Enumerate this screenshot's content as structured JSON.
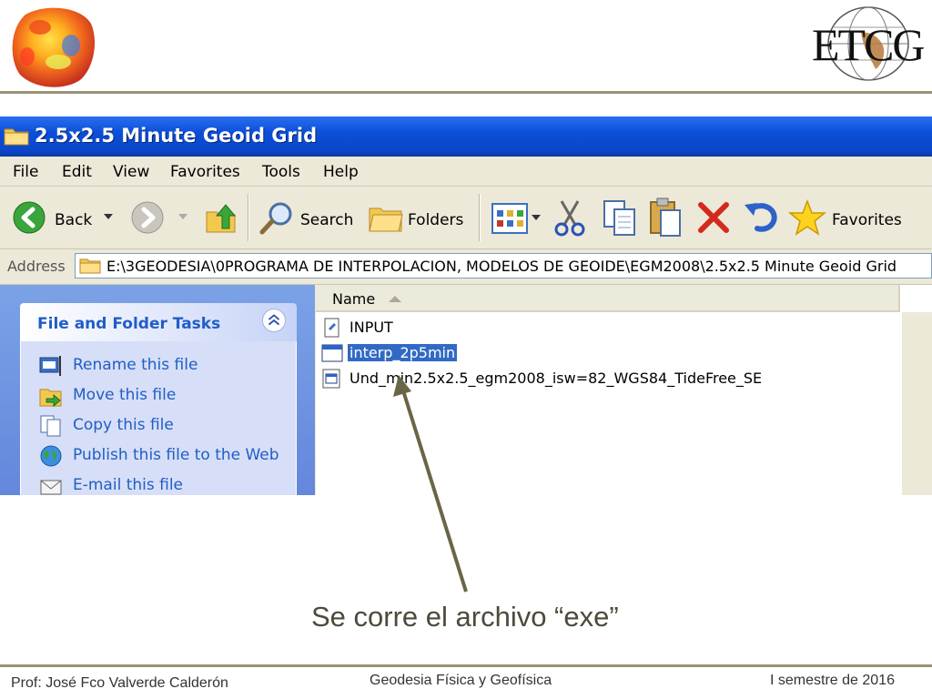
{
  "slide": {
    "logo_text": "ETCG",
    "caption": "Se corre el archivo “exe”",
    "footer": {
      "left": "Prof: José Fco Valverde Calderón",
      "center": "Geodesia Física y Geofísica",
      "right": "I semestre de 2016"
    },
    "colors": {
      "rule": "#9a9374",
      "caption": "#4d4a3a",
      "arrow": "#6b6547"
    }
  },
  "window": {
    "title": "2.5x2.5 Minute Geoid Grid",
    "menu": [
      "File",
      "Edit",
      "View",
      "Favorites",
      "Tools",
      "Help"
    ],
    "toolbar": {
      "back_label": "Back",
      "search_label": "Search",
      "folders_label": "Folders",
      "favorites_label": "Favorites"
    },
    "address": {
      "label": "Address",
      "value": "E:\\3GEODESIA\\0PROGRAMA DE INTERPOLACION, MODELOS DE GEOIDE\\EGM2008\\2.5x2.5 Minute Geoid Grid"
    },
    "tasks": {
      "header": "File and Folder Tasks",
      "items": [
        "Rename this file",
        "Move this file",
        "Copy this file",
        "Publish this file to the Web",
        "E-mail this file"
      ]
    },
    "files": {
      "column_name": "Name",
      "items": [
        "INPUT",
        "interp_2p5min",
        "Und_min2.5x2.5_egm2008_isw=82_WGS84_TideFree_SE"
      ],
      "selected": "interp_2p5min"
    },
    "colors": {
      "titlebar": "#0a46c8",
      "taskpane": "#6f95e1",
      "task_link": "#215dc6",
      "selection": "#316ac5"
    }
  }
}
